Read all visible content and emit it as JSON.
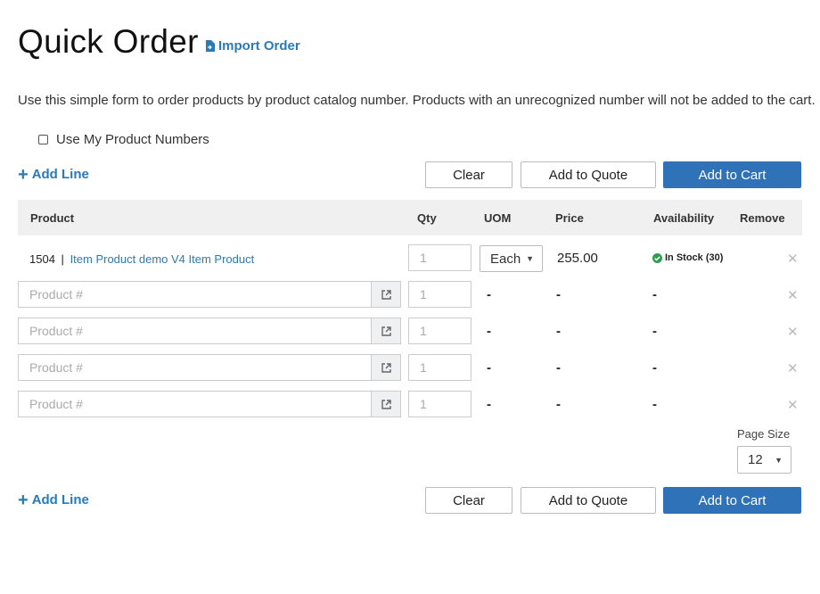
{
  "page": {
    "title": "Quick Order",
    "import_label": "Import Order",
    "description": "Use this simple form to order products by product catalog number. Products with an unrecognized number will not be added to the cart.",
    "use_my_numbers": "Use My Product Numbers"
  },
  "toolbar": {
    "add_line": "Add Line",
    "clear": "Clear",
    "add_to_quote": "Add to Quote",
    "add_to_cart": "Add to Cart"
  },
  "table": {
    "headers": {
      "product": "Product",
      "qty": "Qty",
      "uom": "UOM",
      "price": "Price",
      "availability": "Availability",
      "remove": "Remove"
    },
    "filled_row": {
      "number": "1504",
      "separator": "|",
      "name": "Item Product demo V4 Item Product",
      "qty": "1",
      "uom": "Each",
      "price": "255.00",
      "availability": "In Stock (30)"
    },
    "empty_rows": [
      {
        "placeholder": "Product #",
        "qty": "1",
        "uom": "-",
        "price": "-",
        "availability": "-"
      },
      {
        "placeholder": "Product #",
        "qty": "1",
        "uom": "-",
        "price": "-",
        "availability": "-"
      },
      {
        "placeholder": "Product #",
        "qty": "1",
        "uom": "-",
        "price": "-",
        "availability": "-"
      },
      {
        "placeholder": "Product #",
        "qty": "1",
        "uom": "-",
        "price": "-",
        "availability": "-"
      }
    ]
  },
  "pagination": {
    "label": "Page Size",
    "value": "12"
  },
  "colors": {
    "accent": "#2a7ab8",
    "primary_button": "#2f72b7",
    "in_stock": "#2e9e4f",
    "header_bg": "#f0f0f0"
  },
  "icons": {
    "import": "file-import-icon",
    "external": "external-link-icon",
    "check": "check-circle-icon",
    "remove": "close-icon"
  }
}
